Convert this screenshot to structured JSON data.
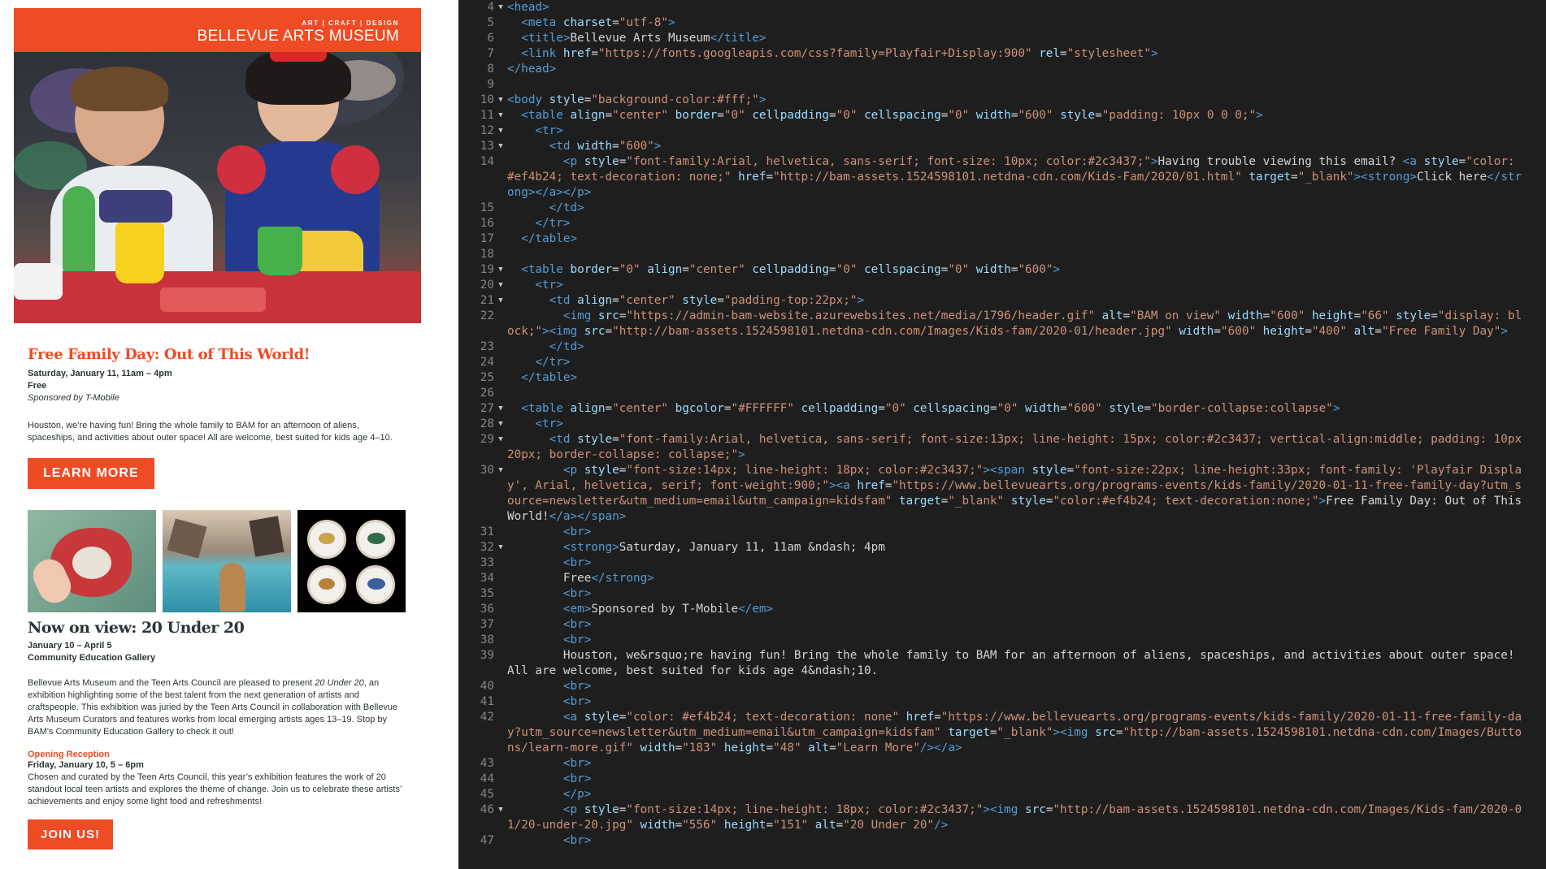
{
  "email": {
    "header": {
      "tagline": "ART | CRAFT | DESIGN",
      "name": "BELLEVUE ARTS MUSEUM"
    },
    "event": {
      "title": "Free Family Day: Out of This World!",
      "date": "Saturday, January 11, 11am – 4pm",
      "price": "Free",
      "sponsor": "Sponsored by T-Mobile",
      "description": "Houston, we’re having fun! Bring the whole family to BAM for an afternoon of aliens, spaceships, and activities about outer space! All are welcome, best suited for kids age 4–10.",
      "cta": "LEARN MORE"
    },
    "exhibition": {
      "title": "Now on view: 20 Under 20",
      "dates": "January 10 – April 5",
      "location": "Community Education Gallery",
      "description_before": "Bellevue Arts Museum and the Teen Arts Council are pleased to present ",
      "description_em": "20 Under 20",
      "description_after": ", an exhibition highlighting some of the best talent from the next generation of artists and craftspeople. This exhibition was juried by the Teen Arts Council in collaboration with Bellevue Arts Museum Curators and features works from local emerging artists ages 13–19. Stop by BAM's Community Education Gallery to check it out!",
      "opening_label": "Opening Reception",
      "opening_date": "Friday, January 10, 5 – 6pm",
      "opening_text": "Chosen and curated by the Teen Arts Council, this year’s exhibition features the work of 20 standout local teen artists and explores the theme of change. Join us to celebrate these artists’ achievements and enjoy some light food and refreshments!",
      "cta": "JOIN US!"
    }
  },
  "editor": {
    "lines": [
      {
        "n": "4",
        "f": "▼",
        "h": "<span class='t'>&lt;head&gt;</span>"
      },
      {
        "n": "5",
        "f": "",
        "h": "  <span class='t'>&lt;meta</span> <span class='a'>charset</span>=<span class='s'>\"utf-8\"</span><span class='t'>&gt;</span>"
      },
      {
        "n": "6",
        "f": "",
        "h": "  <span class='t'>&lt;title&gt;</span>Bellevue Arts Museum<span class='t'>&lt;/title&gt;</span>"
      },
      {
        "n": "7",
        "f": "",
        "h": "  <span class='t'>&lt;link</span> <span class='a'>href</span>=<span class='s'>\"https://fonts.googleapis.com/css?family=Playfair+Display:900\"</span> <span class='a'>rel</span>=<span class='s'>\"stylesheet\"</span><span class='t'>&gt;</span>"
      },
      {
        "n": "8",
        "f": "",
        "h": "<span class='t'>&lt;/head&gt;</span>"
      },
      {
        "n": "9",
        "f": "",
        "h": ""
      },
      {
        "n": "10",
        "f": "▼",
        "h": "<span class='t'>&lt;body</span> <span class='a'>style</span>=<span class='s'>\"background-color:#fff;\"</span><span class='t'>&gt;</span>"
      },
      {
        "n": "11",
        "f": "▼",
        "h": "  <span class='t'>&lt;table</span> <span class='a'>align</span>=<span class='s'>\"center\"</span> <span class='a'>border</span>=<span class='s'>\"0\"</span> <span class='a'>cellpadding</span>=<span class='s'>\"0\"</span> <span class='a'>cellspacing</span>=<span class='s'>\"0\"</span> <span class='a'>width</span>=<span class='s'>\"600\"</span> <span class='a'>style</span>=<span class='s'>\"padding: 10px 0 0 0;\"</span><span class='t'>&gt;</span>"
      },
      {
        "n": "12",
        "f": "▼",
        "h": "    <span class='t'>&lt;tr&gt;</span>"
      },
      {
        "n": "13",
        "f": "▼",
        "h": "      <span class='t'>&lt;td</span> <span class='a'>width</span>=<span class='s'>\"600\"</span><span class='t'>&gt;</span>"
      },
      {
        "n": "14",
        "f": "",
        "h": "        <span class='t'>&lt;p</span> <span class='a'>style</span>=<span class='s'>\"font-family:Arial, helvetica, sans-serif; font-size: 10px; color:#2c3437;\"</span><span class='t'>&gt;</span>Having trouble viewing this email? <span class='t'>&lt;a</span> <span class='a'>style</span>=<span class='s'>\"color: #ef4b24; text-decoration: none;\"</span> <span class='a'>href</span>=<span class='s'>\"http://bam-assets.1524598101.netdna-cdn.com/Kids-Fam/2020/01.html\"</span> <span class='a'>target</span>=<span class='s'>\"_blank\"</span><span class='t'>&gt;&lt;strong&gt;</span>Click here<span class='t'>&lt;/strong&gt;&lt;/a&gt;&lt;/p&gt;</span>"
      },
      {
        "n": "15",
        "f": "",
        "h": "      <span class='t'>&lt;/td&gt;</span>"
      },
      {
        "n": "16",
        "f": "",
        "h": "    <span class='t'>&lt;/tr&gt;</span>"
      },
      {
        "n": "17",
        "f": "",
        "h": "  <span class='t'>&lt;/table&gt;</span>"
      },
      {
        "n": "18",
        "f": "",
        "h": ""
      },
      {
        "n": "19",
        "f": "▼",
        "h": "  <span class='t'>&lt;table</span> <span class='a'>border</span>=<span class='s'>\"0\"</span> <span class='a'>align</span>=<span class='s'>\"center\"</span> <span class='a'>cellpadding</span>=<span class='s'>\"0\"</span> <span class='a'>cellspacing</span>=<span class='s'>\"0\"</span> <span class='a'>width</span>=<span class='s'>\"600\"</span><span class='t'>&gt;</span>"
      },
      {
        "n": "20",
        "f": "▼",
        "h": "    <span class='t'>&lt;tr&gt;</span>"
      },
      {
        "n": "21",
        "f": "▼",
        "h": "      <span class='t'>&lt;td</span> <span class='a'>align</span>=<span class='s'>\"center\"</span> <span class='a'>style</span>=<span class='s'>\"padding-top:22px;\"</span><span class='t'>&gt;</span>"
      },
      {
        "n": "22",
        "f": "",
        "h": "        <span class='t'>&lt;img</span> <span class='a'>src</span>=<span class='s'>\"https://admin-bam-website.azurewebsites.net/media/1796/header.gif\"</span> <span class='a'>alt</span>=<span class='s'>\"BAM on view\"</span> <span class='a'>width</span>=<span class='s'>\"600\"</span> <span class='a'>height</span>=<span class='s'>\"66\"</span> <span class='a'>style</span>=<span class='s'>\"display: block;\"</span><span class='t'>&gt;&lt;img</span> <span class='a'>src</span>=<span class='s'>\"http://bam-assets.1524598101.netdna-cdn.com/Images/Kids-fam/2020-01/header.jpg\"</span> <span class='a'>width</span>=<span class='s'>\"600\"</span> <span class='a'>height</span>=<span class='s'>\"400\"</span> <span class='a'>alt</span>=<span class='s'>\"Free Family Day\"</span><span class='t'>&gt;</span>"
      },
      {
        "n": "23",
        "f": "",
        "h": "      <span class='t'>&lt;/td&gt;</span>"
      },
      {
        "n": "24",
        "f": "",
        "h": "    <span class='t'>&lt;/tr&gt;</span>"
      },
      {
        "n": "25",
        "f": "",
        "h": "  <span class='t'>&lt;/table&gt;</span>"
      },
      {
        "n": "26",
        "f": "",
        "h": ""
      },
      {
        "n": "27",
        "f": "▼",
        "h": "  <span class='t'>&lt;table</span> <span class='a'>align</span>=<span class='s'>\"center\"</span> <span class='a'>bgcolor</span>=<span class='s'>\"#FFFFFF\"</span> <span class='a'>cellpadding</span>=<span class='s'>\"0\"</span> <span class='a'>cellspacing</span>=<span class='s'>\"0\"</span> <span class='a'>width</span>=<span class='s'>\"600\"</span> <span class='a'>style</span>=<span class='s'>\"border-collapse:collapse\"</span><span class='t'>&gt;</span>"
      },
      {
        "n": "28",
        "f": "▼",
        "h": "    <span class='t'>&lt;tr&gt;</span>"
      },
      {
        "n": "29",
        "f": "▼",
        "h": "      <span class='t'>&lt;td</span> <span class='a'>style</span>=<span class='s'>\"font-family:Arial, helvetica, sans-serif; font-size:13px; line-height: 15px; color:#2c3437; vertical-align:middle; padding: 10px 20px; border-collapse: collapse;\"</span><span class='t'>&gt;</span>"
      },
      {
        "n": "30",
        "f": "▼",
        "h": "        <span class='t'>&lt;p</span> <span class='a'>style</span>=<span class='s'>\"font-size:14px; line-height: 18px; color:#2c3437;\"</span><span class='t'>&gt;&lt;span</span> <span class='a'>style</span>=<span class='s'>\"font-size:22px; line-height:33px; font-family: 'Playfair Display', Arial, helvetica, serif; font-weight:900;\"</span><span class='t'>&gt;&lt;a</span> <span class='a'>href</span>=<span class='s'>\"https://www.bellevuearts.org/programs-events/kids-family/2020-01-11-free-family-day?utm_source=newsletter&amp;utm_medium=email&amp;utm_campaign=kidsfam\"</span> <span class='a'>target</span>=<span class='s'>\"_blank\"</span> <span class='a'>style</span>=<span class='s'>\"color:#ef4b24; text-decoration:none;\"</span><span class='t'>&gt;</span>Free Family Day: Out of This World!<span class='t'>&lt;/a&gt;&lt;/span&gt;</span>"
      },
      {
        "n": "31",
        "f": "",
        "h": "        <span class='t'>&lt;br&gt;</span>"
      },
      {
        "n": "32",
        "f": "▼",
        "h": "        <span class='t'>&lt;strong&gt;</span>Saturday, January 11, 11am &amp;ndash; 4pm"
      },
      {
        "n": "33",
        "f": "",
        "h": "        <span class='t'>&lt;br&gt;</span>"
      },
      {
        "n": "34",
        "f": "",
        "h": "        Free<span class='t'>&lt;/strong&gt;</span>"
      },
      {
        "n": "35",
        "f": "",
        "h": "        <span class='t'>&lt;br&gt;</span>"
      },
      {
        "n": "36",
        "f": "",
        "h": "        <span class='t'>&lt;em&gt;</span>Sponsored by T-Mobile<span class='t'>&lt;/em&gt;</span>"
      },
      {
        "n": "37",
        "f": "",
        "h": "        <span class='t'>&lt;br&gt;</span>"
      },
      {
        "n": "38",
        "f": "",
        "h": "        <span class='t'>&lt;br&gt;</span>"
      },
      {
        "n": "39",
        "f": "",
        "h": "        Houston, we&amp;rsquo;re having fun! Bring the whole family to BAM for an afternoon of aliens, spaceships, and activities about outer space! All are welcome, best suited for kids age 4&amp;ndash;10."
      },
      {
        "n": "40",
        "f": "",
        "h": "        <span class='t'>&lt;br&gt;</span>"
      },
      {
        "n": "41",
        "f": "",
        "h": "        <span class='t'>&lt;br&gt;</span>"
      },
      {
        "n": "42",
        "f": "",
        "h": "        <span class='t'>&lt;a</span> <span class='a'>style</span>=<span class='s'>\"color: #ef4b24; text-decoration: none\"</span> <span class='a'>href</span>=<span class='s'>\"https://www.bellevuearts.org/programs-events/kids-family/2020-01-11-free-family-day?utm_source=newsletter&amp;utm_medium=email&amp;utm_campaign=kidsfam\"</span> <span class='a'>target</span>=<span class='s'>\"_blank\"</span><span class='t'>&gt;&lt;img</span> <span class='a'>src</span>=<span class='s'>\"http://bam-assets.1524598101.netdna-cdn.com/Images/Buttons/learn-more.gif\"</span> <span class='a'>width</span>=<span class='s'>\"183\"</span> <span class='a'>height</span>=<span class='s'>\"48\"</span> <span class='a'>alt</span>=<span class='s'>\"Learn More\"</span><span class='t'>/&gt;&lt;/a&gt;</span>"
      },
      {
        "n": "43",
        "f": "",
        "h": "        <span class='t'>&lt;br&gt;</span>"
      },
      {
        "n": "44",
        "f": "",
        "h": "        <span class='t'>&lt;br&gt;</span>"
      },
      {
        "n": "45",
        "f": "",
        "h": "        <span class='t'>&lt;/p&gt;</span>"
      },
      {
        "n": "46",
        "f": "▼",
        "h": "        <span class='t'>&lt;p</span> <span class='a'>style</span>=<span class='s'>\"font-size:14px; line-height: 18px; color:#2c3437;\"</span><span class='t'>&gt;&lt;img</span> <span class='a'>src</span>=<span class='s'>\"http://bam-assets.1524598101.netdna-cdn.com/Images/Kids-fam/2020-01/20-under-20.jpg\"</span> <span class='a'>width</span>=<span class='s'>\"556\"</span> <span class='a'>height</span>=<span class='s'>\"151\"</span> <span class='a'>alt</span>=<span class='s'>\"20 Under 20\"</span><span class='t'>/&gt;</span>"
      },
      {
        "n": "47",
        "f": "",
        "h": "        <span class='t'>&lt;br&gt;</span>"
      }
    ]
  }
}
